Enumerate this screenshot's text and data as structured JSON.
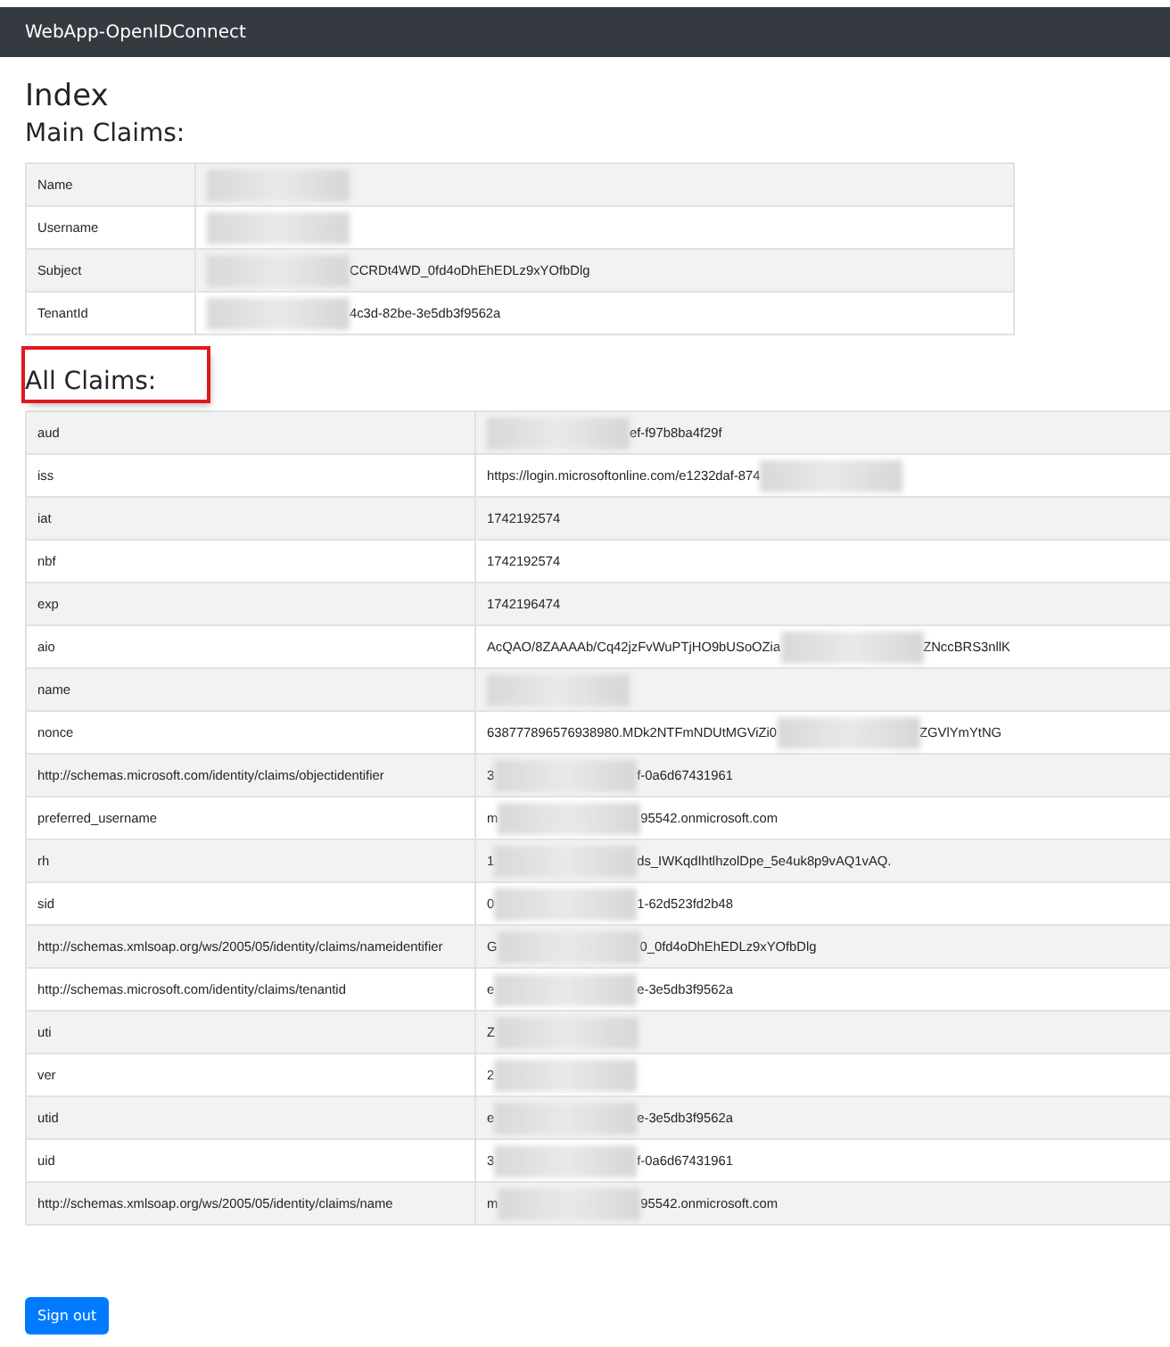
{
  "navbar": {
    "brand": "WebApp-OpenIDConnect"
  },
  "page_title": "Index",
  "main_claims": {
    "heading": "Main Claims:",
    "highlighted": false,
    "rows": [
      {
        "label": "Name",
        "redacted": true
      },
      {
        "label": "Username",
        "redacted": true
      },
      {
        "label": "Subject",
        "redacted": true,
        "after": "CCRDt4WD_0fd4oDhEhEDLz9xYOfbDlg"
      },
      {
        "label": "TenantId",
        "redacted": true,
        "after": "4c3d-82be-3e5db3f9562a"
      }
    ]
  },
  "all_claims": {
    "heading": "All Claims:",
    "highlighted": true,
    "rows": [
      {
        "label": "aud",
        "redacted": true,
        "after": "ef-f97b8ba4f29f"
      },
      {
        "label": "iss",
        "redacted": true,
        "before": "https://login.microsoftonline.com/e1232daf-874"
      },
      {
        "label": "iat",
        "redacted": false,
        "before": "1742192574"
      },
      {
        "label": "nbf",
        "redacted": false,
        "before": "1742192574"
      },
      {
        "label": "exp",
        "redacted": false,
        "before": "1742196474"
      },
      {
        "label": "aio",
        "redacted": true,
        "before": "AcQAO/8ZAAAAb/Cq42jzFvWuPTjHO9bUSoOZia",
        "after": "ZNccBRS3nllK"
      },
      {
        "label": "name",
        "redacted": true
      },
      {
        "label": "nonce",
        "redacted": true,
        "before": "638777896576938980.MDk2NTFmNDUtMGViZi0",
        "after": "ZGVlYmYtNG"
      },
      {
        "label": "http://schemas.microsoft.com/identity/claims/objectidentifier",
        "redacted": true,
        "before": "3",
        "after": "f-0a6d67431961"
      },
      {
        "label": "preferred_username",
        "redacted": true,
        "before": "m",
        "after": "95542.onmicrosoft.com"
      },
      {
        "label": "rh",
        "redacted": true,
        "before": "1",
        "after": "ds_IWKqdIhtlhzolDpe_5e4uk8p9vAQ1vAQ."
      },
      {
        "label": "sid",
        "redacted": true,
        "before": "0",
        "after": "1-62d523fd2b48"
      },
      {
        "label": "http://schemas.xmlsoap.org/ws/2005/05/identity/claims/nameidentifier",
        "redacted": true,
        "before": "G",
        "after": "0_0fd4oDhEhEDLz9xYOfbDlg"
      },
      {
        "label": "http://schemas.microsoft.com/identity/claims/tenantid",
        "redacted": true,
        "before": "e",
        "after": "e-3e5db3f9562a"
      },
      {
        "label": "uti",
        "redacted": true,
        "before": "Z"
      },
      {
        "label": "ver",
        "redacted": true,
        "before": "2"
      },
      {
        "label": "utid",
        "redacted": true,
        "before": "e",
        "after": "e-3e5db3f9562a"
      },
      {
        "label": "uid",
        "redacted": true,
        "before": "3",
        "after": "f-0a6d67431961"
      },
      {
        "label": "http://schemas.xmlsoap.org/ws/2005/05/identity/claims/name",
        "redacted": true,
        "before": "m",
        "after": "95542.onmicrosoft.com"
      }
    ]
  },
  "sign_out": {
    "label": "Sign out"
  }
}
